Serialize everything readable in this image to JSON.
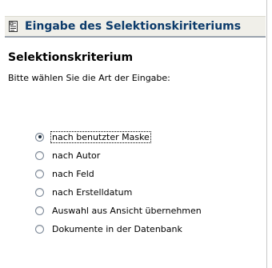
{
  "window": {
    "title": "Eingabe des Selektionskiriteriums"
  },
  "section": {
    "heading": "Selektionskriterium",
    "instruction": "Bitte wählen Sie die Art der Eingabe:"
  },
  "options": [
    {
      "label": "nach benutzter Maske",
      "selected": true
    },
    {
      "label": "nach Autor",
      "selected": false
    },
    {
      "label": "nach Feld",
      "selected": false
    },
    {
      "label": "nach Erstelldatum",
      "selected": false
    },
    {
      "label": "Auswahl aus Ansicht übernehmen",
      "selected": false
    },
    {
      "label": "Dokumente in der Datenbank",
      "selected": false
    }
  ]
}
